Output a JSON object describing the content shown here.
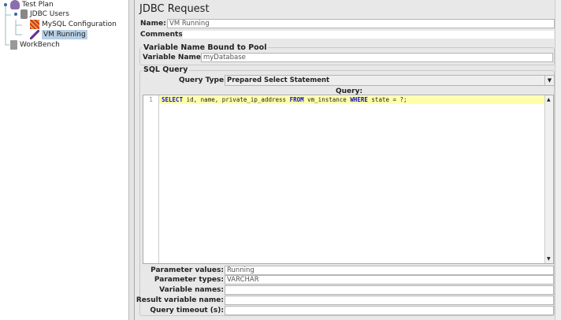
{
  "tree": [
    {
      "label": "Test Plan",
      "icon": "test-plan-icon"
    },
    {
      "label": "JDBC Users",
      "icon": "thread-group-icon"
    },
    {
      "label": "MySQL Configuration",
      "icon": "config-icon"
    },
    {
      "label": "VM Running",
      "icon": "sampler-pipette-icon",
      "selected": true
    },
    {
      "label": "WorkBench",
      "icon": "workbench-icon"
    }
  ],
  "panel": {
    "title": "JDBC Request",
    "name_label": "Name:",
    "name_value": "VM Running",
    "comments_label": "Comments:",
    "comments_value": "",
    "pool_group": "Variable Name Bound to Pool",
    "var_label": "Variable Name:",
    "var_value": "myDatabase",
    "sql_group": "SQL Query",
    "qtype_label": "Query Type:",
    "qtype_value": "Prepared Select Statement",
    "query_label": "Query:",
    "line_number": "1",
    "query": {
      "k1": "SELECT",
      "t1": " id, name, private_ip_address ",
      "k2": "FROM",
      "t2": " vm_instance ",
      "k3": "WHERE",
      "t3": " state = ?;"
    },
    "params": [
      {
        "label": "Parameter values:",
        "value": "Running"
      },
      {
        "label": "Parameter types:",
        "value": "VARCHAR"
      },
      {
        "label": "Variable names:",
        "value": ""
      },
      {
        "label": "Result variable name:",
        "value": ""
      },
      {
        "label": "Query timeout (s):",
        "value": ""
      }
    ]
  }
}
